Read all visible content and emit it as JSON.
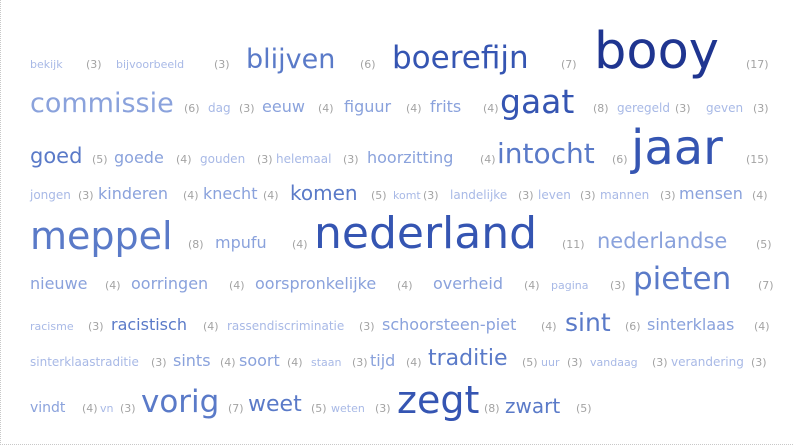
{
  "palette": {
    "darkest": "#1f3590",
    "dark": "#3555b2",
    "mid": "#5a7ac8",
    "light": "#8aa2dc",
    "lightest": "#a8b9e6",
    "count": "#a3a3a3"
  },
  "tags": [
    {
      "word": "bekijk",
      "count": "(3)"
    },
    {
      "word": "bijvoorbeeld",
      "count": "(3)"
    },
    {
      "word": "blijven",
      "count": "(6)"
    },
    {
      "word": "boerefijn",
      "count": "(7)"
    },
    {
      "word": "booy",
      "count": "(17)"
    },
    {
      "word": "commissie",
      "count": "(6)"
    },
    {
      "word": "dag",
      "count": "(3)"
    },
    {
      "word": "eeuw",
      "count": "(4)"
    },
    {
      "word": "figuur",
      "count": "(4)"
    },
    {
      "word": "frits",
      "count": "(4)"
    },
    {
      "word": "gaat",
      "count": "(8)"
    },
    {
      "word": "geregeld",
      "count": "(3)"
    },
    {
      "word": "geven",
      "count": "(3)"
    },
    {
      "word": "goed",
      "count": "(5)"
    },
    {
      "word": "goede",
      "count": "(4)"
    },
    {
      "word": "gouden",
      "count": "(3)"
    },
    {
      "word": "helemaal",
      "count": "(3)"
    },
    {
      "word": "hoorzitting",
      "count": "(4)"
    },
    {
      "word": "intocht",
      "count": "(6)"
    },
    {
      "word": "jaar",
      "count": "(15)"
    },
    {
      "word": "jongen",
      "count": "(3)"
    },
    {
      "word": "kinderen",
      "count": "(4)"
    },
    {
      "word": "knecht",
      "count": "(4)"
    },
    {
      "word": "komen",
      "count": "(5)"
    },
    {
      "word": "komt",
      "count": "(3)"
    },
    {
      "word": "landelijke",
      "count": "(3)"
    },
    {
      "word": "leven",
      "count": "(3)"
    },
    {
      "word": "mannen",
      "count": "(3)"
    },
    {
      "word": "mensen",
      "count": "(4)"
    },
    {
      "word": "meppel",
      "count": "(8)"
    },
    {
      "word": "mpufu",
      "count": "(4)"
    },
    {
      "word": "nederland",
      "count": "(11)"
    },
    {
      "word": "nederlandse",
      "count": "(5)"
    },
    {
      "word": "nieuwe",
      "count": "(4)"
    },
    {
      "word": "oorringen",
      "count": "(4)"
    },
    {
      "word": "oorspronkelijke",
      "count": "(4)"
    },
    {
      "word": "overheid",
      "count": "(4)"
    },
    {
      "word": "pagina",
      "count": "(3)"
    },
    {
      "word": "pieten",
      "count": "(7)"
    },
    {
      "word": "racisme",
      "count": "(3)"
    },
    {
      "word": "racistisch",
      "count": "(4)"
    },
    {
      "word": "rassendiscriminatie",
      "count": "(3)"
    },
    {
      "word": "schoorsteen-piet",
      "count": "(4)"
    },
    {
      "word": "sint",
      "count": "(6)"
    },
    {
      "word": "sinterklaas",
      "count": "(4)"
    },
    {
      "word": "sinterklaastraditie",
      "count": "(3)"
    },
    {
      "word": "sints",
      "count": "(4)"
    },
    {
      "word": "soort",
      "count": "(4)"
    },
    {
      "word": "staan",
      "count": "(3)"
    },
    {
      "word": "tijd",
      "count": "(4)"
    },
    {
      "word": "traditie",
      "count": "(5)"
    },
    {
      "word": "uur",
      "count": "(3)"
    },
    {
      "word": "vandaag",
      "count": "(3)"
    },
    {
      "word": "verandering",
      "count": "(3)"
    },
    {
      "word": "vindt",
      "count": "(4)"
    },
    {
      "word": "vn",
      "count": "(3)"
    },
    {
      "word": "vorig",
      "count": "(7)"
    },
    {
      "word": "weet",
      "count": "(5)"
    },
    {
      "word": "weten",
      "count": "(3)"
    },
    {
      "word": "zegt",
      "count": "(8)"
    },
    {
      "word": "zwart",
      "count": "(5)"
    }
  ]
}
